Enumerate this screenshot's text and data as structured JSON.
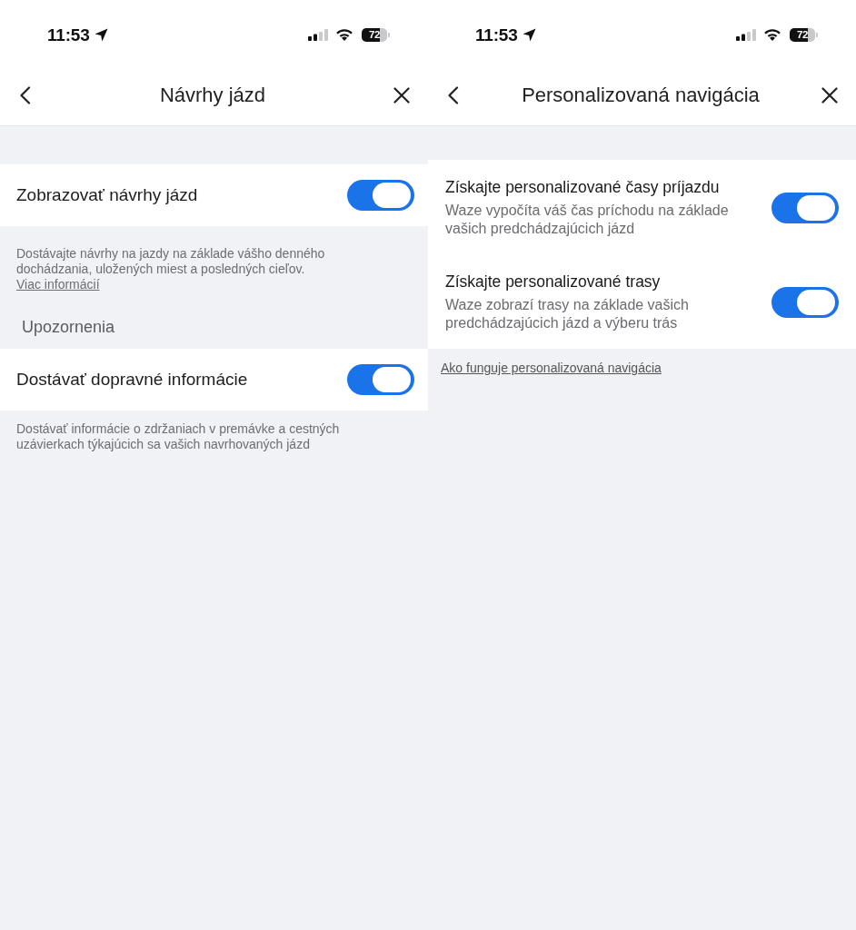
{
  "screens": [
    {
      "status_bar": {
        "time": "11:53",
        "battery": "72"
      },
      "header": {
        "title": "Návrhy jázd"
      },
      "content": [
        {
          "kind": "toggle_row",
          "label": "Zobrazovať návrhy jázd",
          "on": true
        },
        {
          "kind": "note",
          "text": "Dostávajte návrhy na jazdy na základe vášho denného dochádzania, uložených miest a posledných cieľov.",
          "link": "Viac informácií"
        },
        {
          "kind": "section_header",
          "text": "Upozornenia"
        },
        {
          "kind": "toggle_row",
          "label": "Dostávať dopravné informácie",
          "on": true
        },
        {
          "kind": "note",
          "text": "Dostávať informácie o zdržaniach v premávke a cestných uzávierkach týkajúcich sa vašich navrhovaných jázd"
        }
      ]
    },
    {
      "status_bar": {
        "time": "11:53",
        "battery": "72"
      },
      "header": {
        "title": "Personalizovaná navigácia"
      },
      "content": [
        {
          "kind": "toggle_group",
          "items": [
            {
              "title": "Získajte personalizované časy príjazdu",
              "description": "Waze vypočíta váš čas príchodu na základe vašich predchádzajúcich jázd",
              "on": true
            },
            {
              "title": "Získajte personalizované trasy",
              "description": "Waze zobrazí trasy na základe vašich predchádzajúcich jázd a výberu trás",
              "on": true
            }
          ]
        },
        {
          "kind": "link",
          "text": "Ako funguje personalizovaná navigácia"
        }
      ]
    }
  ]
}
